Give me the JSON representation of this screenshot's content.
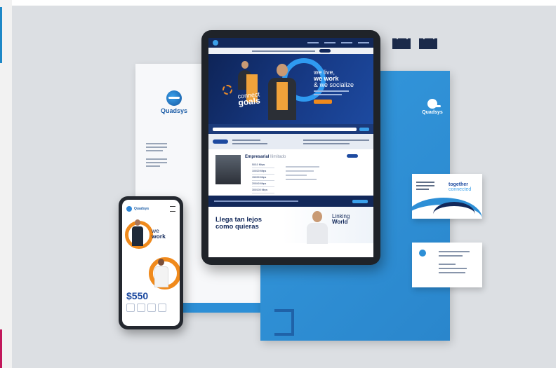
{
  "brand": {
    "name": "Quadsys",
    "colors": {
      "primary": "#1d4aa0",
      "navy": "#12285a",
      "accent": "#f08a1c",
      "light_blue": "#2d8fd6"
    }
  },
  "tablet": {
    "hero": {
      "connect": "connect",
      "goals": "goals",
      "line1": "we live,",
      "line2": "we work",
      "line3": "& we socialize"
    },
    "plans": {
      "title_bold": "Empresarial",
      "title_light": "Ilimitado",
      "list": [
        "50/10 Mbps",
        "100/20 Mbps",
        "150/30 Mbps",
        "200/40 Mbps",
        "300/100 Mbps"
      ]
    },
    "bottom": {
      "headline": "Llega tan lejos como quieras",
      "linking": "Linking",
      "world": "World"
    }
  },
  "phone": {
    "brand": "Quadsys",
    "we": "we",
    "work": "work",
    "price": "$550"
  },
  "card": {
    "together": "together",
    "connected": "connected"
  }
}
